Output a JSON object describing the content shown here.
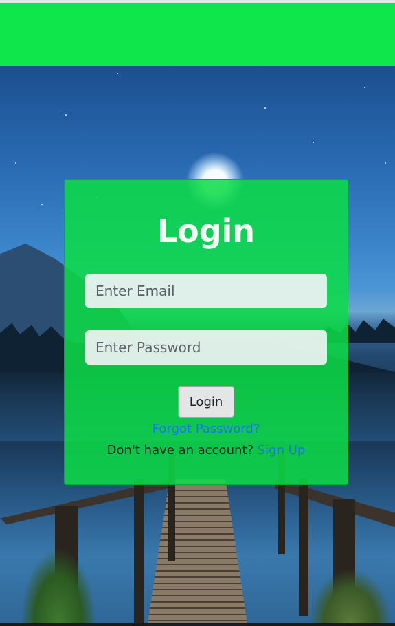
{
  "login": {
    "title": "Login",
    "email_placeholder": "Enter Email",
    "password_placeholder": "Enter Password",
    "login_button": "Login",
    "forgot_password": "Forgot Password?",
    "signup_prompt": "Don't have an account?",
    "signup_link": "Sign Up"
  },
  "colors": {
    "header": "#0fe64b",
    "card": "#0cdc46",
    "link": "#1b73e8"
  }
}
